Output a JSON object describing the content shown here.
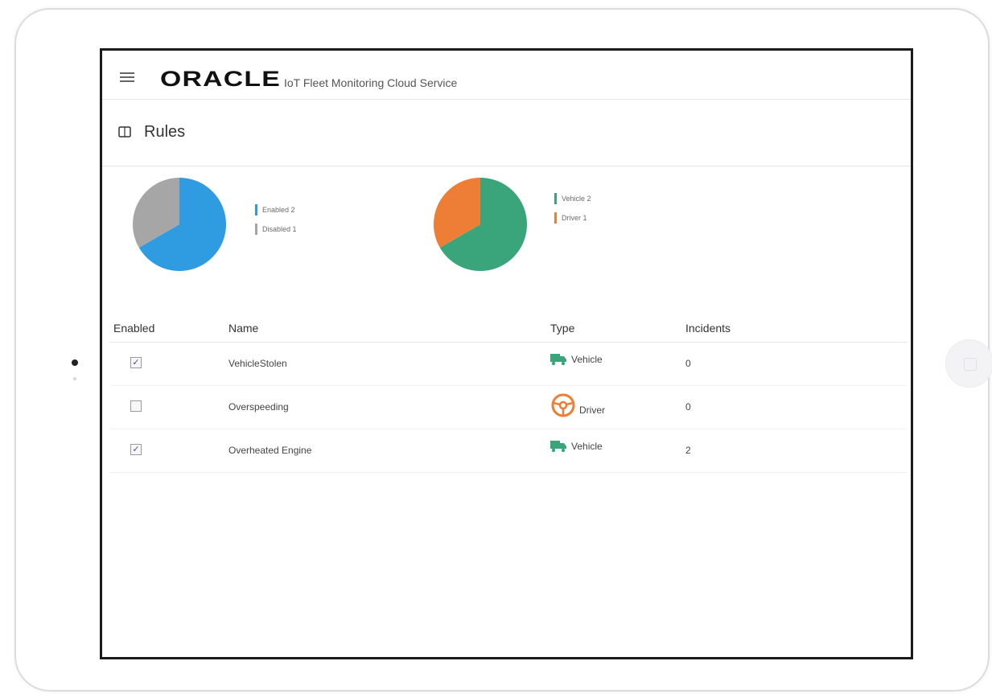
{
  "app": {
    "brand": "ORACLE",
    "service_name": "IoT Fleet Monitoring Cloud Service"
  },
  "page": {
    "title": "Rules"
  },
  "charts": {
    "status": {
      "legend": [
        {
          "label": "Enabled 2",
          "color": "#2f9be0"
        },
        {
          "label": "Disabled 1",
          "color": "#a6a6a6"
        }
      ]
    },
    "type": {
      "legend": [
        {
          "label": "Vehicle 2",
          "color": "#3aa57a"
        },
        {
          "label": "Driver 1",
          "color": "#ee7d35"
        }
      ]
    }
  },
  "chart_data": [
    {
      "type": "pie",
      "categories": [
        "Enabled",
        "Disabled"
      ],
      "values": [
        2,
        1
      ],
      "colors": [
        "#2f9be0",
        "#a6a6a6"
      ],
      "legend_position": "right"
    },
    {
      "type": "pie",
      "categories": [
        "Vehicle",
        "Driver"
      ],
      "values": [
        2,
        1
      ],
      "colors": [
        "#3aa57a",
        "#ee7d35"
      ],
      "legend_position": "right"
    }
  ],
  "table": {
    "headers": {
      "enabled": "Enabled",
      "name": "Name",
      "type": "Type",
      "incidents": "Incidents"
    },
    "rows": [
      {
        "enabled": true,
        "name": "VehicleStolen",
        "type": "Vehicle",
        "icon": "truck-icon",
        "incidents": "0"
      },
      {
        "enabled": false,
        "name": "Overspeeding",
        "type": "Driver",
        "icon": "steering-wheel-icon",
        "incidents": "0"
      },
      {
        "enabled": true,
        "name": "Overheated Engine",
        "type": "Vehicle",
        "icon": "truck-icon",
        "incidents": "2"
      }
    ]
  },
  "colors": {
    "enabled": "#2f9be0",
    "disabled": "#a6a6a6",
    "vehicle": "#3aa57a",
    "driver": "#ee7d35"
  }
}
